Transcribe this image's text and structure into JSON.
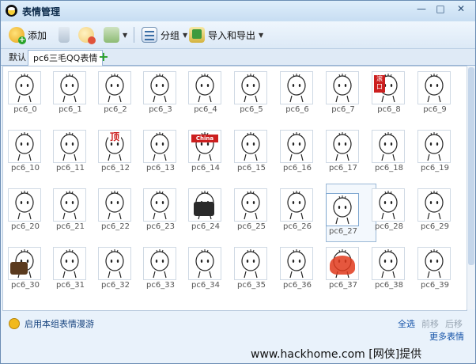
{
  "window": {
    "title": "表情管理",
    "min_glyph": "—",
    "max_glyph": "□",
    "close_glyph": "✕"
  },
  "toolbar": {
    "add_label": "添加",
    "group_label": "分组",
    "import_export_label": "导入和导出",
    "icons": [
      "add-icon",
      "delete-icon",
      "clear-icon",
      "move-icon",
      "group-icon",
      "import-export-icon"
    ]
  },
  "tabs": {
    "default_label": "默认",
    "active_label": "pc6三毛QQ表情",
    "add_glyph": "+"
  },
  "emojis": [
    "pc6_0",
    "pc6_1",
    "pc6_2",
    "pc6_3",
    "pc6_4",
    "pc6_5",
    "pc6_6",
    "pc6_7",
    "pc6_8",
    "pc6_9",
    "pc6_10",
    "pc6_11",
    "pc6_12",
    "pc6_13",
    "pc6_14",
    "pc6_15",
    "pc6_16",
    "pc6_17",
    "pc6_18",
    "pc6_19",
    "pc6_20",
    "pc6_21",
    "pc6_22",
    "pc6_23",
    "pc6_24",
    "pc6_25",
    "pc6_26",
    "pc6_27",
    "pc6_28",
    "pc6_29",
    "pc6_30",
    "pc6_31",
    "pc6_32",
    "pc6_33",
    "pc6_34",
    "pc6_35",
    "pc6_36",
    "pc6_37",
    "pc6_38",
    "pc6_39"
  ],
  "emoji_texts": {
    "e8": "滚 口",
    "e12": "顶",
    "e14": "China"
  },
  "bottom": {
    "roam_label": "启用本组表情漫游",
    "select_all": "全选",
    "move_left": "前移",
    "move_right": "后移",
    "more": "更多表情"
  },
  "watermark": "www.hackhome.com [网侠]提供",
  "colors": {
    "accent": "#1553a8",
    "border": "#98b5d5"
  }
}
